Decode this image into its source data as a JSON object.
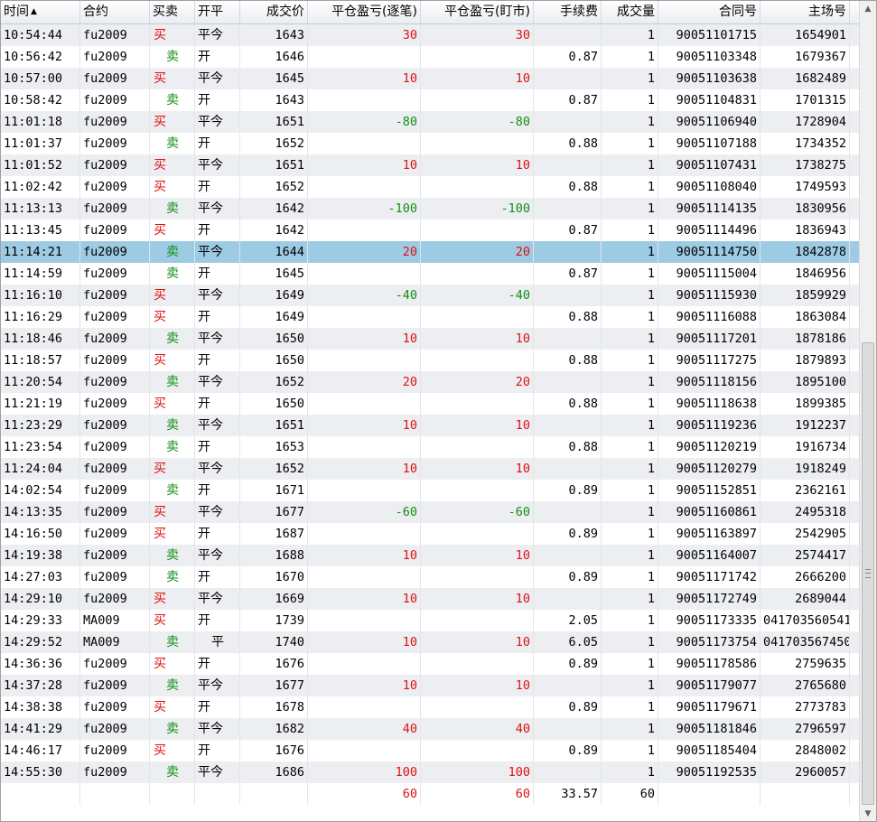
{
  "columns": [
    {
      "label": "时间",
      "align": "left",
      "sorted": true
    },
    {
      "label": "合约",
      "align": "left"
    },
    {
      "label": "买卖",
      "align": "left"
    },
    {
      "label": "开平",
      "align": "left"
    },
    {
      "label": "成交价",
      "align": "right"
    },
    {
      "label": "平仓盈亏(逐笔)",
      "align": "right"
    },
    {
      "label": "平仓盈亏(盯市)",
      "align": "right"
    },
    {
      "label": "手续费",
      "align": "right"
    },
    {
      "label": "成交量",
      "align": "right"
    },
    {
      "label": "合同号",
      "align": "right"
    },
    {
      "label": "主场号",
      "align": "right"
    }
  ],
  "sort_indicator": "▲",
  "selected_row_index": 10,
  "colors": {
    "buy": "#e01010",
    "sell": "#109010",
    "profit": "#e01010",
    "loss": "#109010",
    "selected": "#9dcbe4"
  },
  "rows": [
    [
      "10:54:44",
      "fu2009",
      "买",
      "平今",
      "1643",
      "30",
      "30",
      "",
      "1",
      "90051101715",
      "1654901"
    ],
    [
      "10:56:42",
      "fu2009",
      "卖",
      "开",
      "1646",
      "",
      "",
      "0.87",
      "1",
      "90051103348",
      "1679367"
    ],
    [
      "10:57:00",
      "fu2009",
      "买",
      "平今",
      "1645",
      "10",
      "10",
      "",
      "1",
      "90051103638",
      "1682489"
    ],
    [
      "10:58:42",
      "fu2009",
      "卖",
      "开",
      "1643",
      "",
      "",
      "0.87",
      "1",
      "90051104831",
      "1701315"
    ],
    [
      "11:01:18",
      "fu2009",
      "买",
      "平今",
      "1651",
      "-80",
      "-80",
      "",
      "1",
      "90051106940",
      "1728904"
    ],
    [
      "11:01:37",
      "fu2009",
      "卖",
      "开",
      "1652",
      "",
      "",
      "0.88",
      "1",
      "90051107188",
      "1734352"
    ],
    [
      "11:01:52",
      "fu2009",
      "买",
      "平今",
      "1651",
      "10",
      "10",
      "",
      "1",
      "90051107431",
      "1738275"
    ],
    [
      "11:02:42",
      "fu2009",
      "买",
      "开",
      "1652",
      "",
      "",
      "0.88",
      "1",
      "90051108040",
      "1749593"
    ],
    [
      "11:13:13",
      "fu2009",
      "卖",
      "平今",
      "1642",
      "-100",
      "-100",
      "",
      "1",
      "90051114135",
      "1830956"
    ],
    [
      "11:13:45",
      "fu2009",
      "买",
      "开",
      "1642",
      "",
      "",
      "0.87",
      "1",
      "90051114496",
      "1836943"
    ],
    [
      "11:14:21",
      "fu2009",
      "卖",
      "平今",
      "1644",
      "20",
      "20",
      "",
      "1",
      "90051114750",
      "1842878"
    ],
    [
      "11:14:59",
      "fu2009",
      "卖",
      "开",
      "1645",
      "",
      "",
      "0.87",
      "1",
      "90051115004",
      "1846956"
    ],
    [
      "11:16:10",
      "fu2009",
      "买",
      "平今",
      "1649",
      "-40",
      "-40",
      "",
      "1",
      "90051115930",
      "1859929"
    ],
    [
      "11:16:29",
      "fu2009",
      "买",
      "开",
      "1649",
      "",
      "",
      "0.88",
      "1",
      "90051116088",
      "1863084"
    ],
    [
      "11:18:46",
      "fu2009",
      "卖",
      "平今",
      "1650",
      "10",
      "10",
      "",
      "1",
      "90051117201",
      "1878186"
    ],
    [
      "11:18:57",
      "fu2009",
      "买",
      "开",
      "1650",
      "",
      "",
      "0.88",
      "1",
      "90051117275",
      "1879893"
    ],
    [
      "11:20:54",
      "fu2009",
      "卖",
      "平今",
      "1652",
      "20",
      "20",
      "",
      "1",
      "90051118156",
      "1895100"
    ],
    [
      "11:21:19",
      "fu2009",
      "买",
      "开",
      "1650",
      "",
      "",
      "0.88",
      "1",
      "90051118638",
      "1899385"
    ],
    [
      "11:23:29",
      "fu2009",
      "卖",
      "平今",
      "1651",
      "10",
      "10",
      "",
      "1",
      "90051119236",
      "1912237"
    ],
    [
      "11:23:54",
      "fu2009",
      "卖",
      "开",
      "1653",
      "",
      "",
      "0.88",
      "1",
      "90051120219",
      "1916734"
    ],
    [
      "11:24:04",
      "fu2009",
      "买",
      "平今",
      "1652",
      "10",
      "10",
      "",
      "1",
      "90051120279",
      "1918249"
    ],
    [
      "14:02:54",
      "fu2009",
      "卖",
      "开",
      "1671",
      "",
      "",
      "0.89",
      "1",
      "90051152851",
      "2362161"
    ],
    [
      "14:13:35",
      "fu2009",
      "买",
      "平今",
      "1677",
      "-60",
      "-60",
      "",
      "1",
      "90051160861",
      "2495318"
    ],
    [
      "14:16:50",
      "fu2009",
      "买",
      "开",
      "1687",
      "",
      "",
      "0.89",
      "1",
      "90051163897",
      "2542905"
    ],
    [
      "14:19:38",
      "fu2009",
      "卖",
      "平今",
      "1688",
      "10",
      "10",
      "",
      "1",
      "90051164007",
      "2574417"
    ],
    [
      "14:27:03",
      "fu2009",
      "卖",
      "开",
      "1670",
      "",
      "",
      "0.89",
      "1",
      "90051171742",
      "2666200"
    ],
    [
      "14:29:10",
      "fu2009",
      "买",
      "平今",
      "1669",
      "10",
      "10",
      "",
      "1",
      "90051172749",
      "2689044"
    ],
    [
      "14:29:33",
      "MA009",
      "买",
      "开",
      "1739",
      "",
      "",
      "2.05",
      "1",
      "90051173335",
      "041703560541"
    ],
    [
      "14:29:52",
      "MA009",
      "卖",
      "平",
      "1740",
      "10",
      "10",
      "6.05",
      "1",
      "90051173754",
      "041703567450"
    ],
    [
      "14:36:36",
      "fu2009",
      "买",
      "开",
      "1676",
      "",
      "",
      "0.89",
      "1",
      "90051178586",
      "2759635"
    ],
    [
      "14:37:28",
      "fu2009",
      "卖",
      "平今",
      "1677",
      "10",
      "10",
      "",
      "1",
      "90051179077",
      "2765680"
    ],
    [
      "14:38:38",
      "fu2009",
      "买",
      "开",
      "1678",
      "",
      "",
      "0.89",
      "1",
      "90051179671",
      "2773783"
    ],
    [
      "14:41:29",
      "fu2009",
      "卖",
      "平今",
      "1682",
      "40",
      "40",
      "",
      "1",
      "90051181846",
      "2796597"
    ],
    [
      "14:46:17",
      "fu2009",
      "买",
      "开",
      "1676",
      "",
      "",
      "0.89",
      "1",
      "90051185404",
      "2848002"
    ],
    [
      "14:55:30",
      "fu2009",
      "卖",
      "平今",
      "1686",
      "100",
      "100",
      "",
      "1",
      "90051192535",
      "2960057"
    ]
  ],
  "totals": [
    "",
    "",
    "",
    "",
    "",
    "60",
    "60",
    "33.57",
    "60",
    "",
    ""
  ],
  "scrollbar": {
    "up_icon": "▲",
    "down_icon": "▼"
  }
}
